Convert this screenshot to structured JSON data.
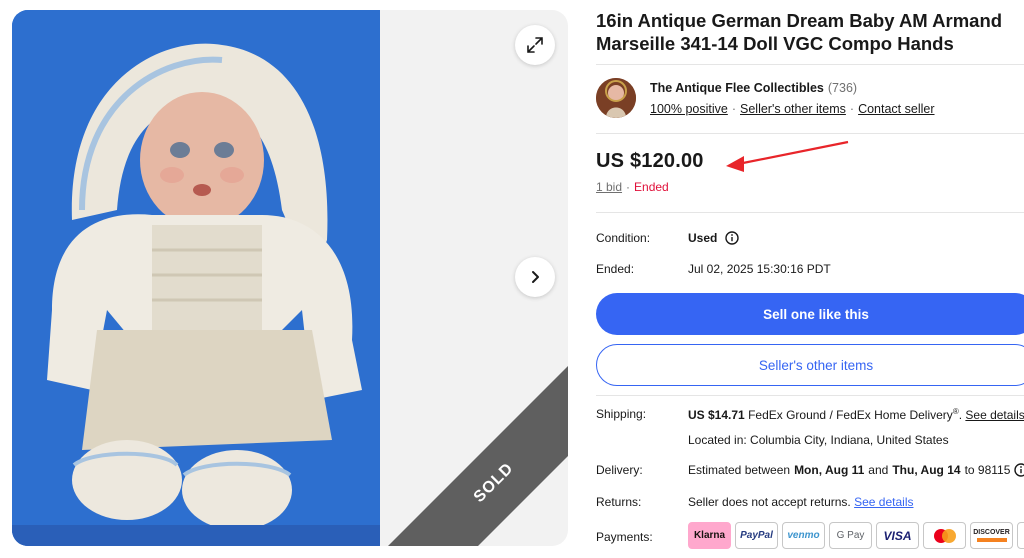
{
  "listing": {
    "title": "16in Antique German Dream Baby AM Armand Marseille 341-14 Doll VGC Compo Hands",
    "sold_banner": "SOLD"
  },
  "seller": {
    "name": "The Antique Flee Collectibles",
    "feedback_count": "(736)",
    "positive": "100% positive",
    "other_items": "Seller's other items",
    "contact": "Contact seller"
  },
  "price": {
    "amount": "US $120.00",
    "bids": "1 bid",
    "separator": "·",
    "status": "Ended"
  },
  "details": {
    "condition_label": "Condition:",
    "condition_value": "Used",
    "ended_label": "Ended:",
    "ended_value": "Jul 02, 2025 15:30:16 PDT"
  },
  "buttons": {
    "primary": "Sell one like this",
    "secondary": "Seller's other items"
  },
  "shipping": {
    "label": "Shipping:",
    "cost": "US $14.71",
    "service": "FedEx Ground / FedEx Home Delivery",
    "registered": "®",
    "see_details": "See details",
    "location": "Located in: Columbia City, Indiana, United States"
  },
  "delivery": {
    "label": "Delivery:",
    "prefix": "Estimated between",
    "start": "Mon, Aug 11",
    "and": "and",
    "end": "Thu, Aug 14",
    "to": "to 98115"
  },
  "returns": {
    "label": "Returns:",
    "text": "Seller does not accept returns.",
    "see_details": "See details"
  },
  "payments": {
    "label": "Payments:",
    "methods": [
      "Klarna",
      "PayPal",
      "venmo",
      "G Pay",
      "VISA",
      "Mastercard",
      "DISCOVER"
    ]
  },
  "colors": {
    "accent": "#3665f3",
    "ended": "#e0103a",
    "photo_background": "#2f73d6",
    "annotation_arrow": "#e8252a"
  }
}
